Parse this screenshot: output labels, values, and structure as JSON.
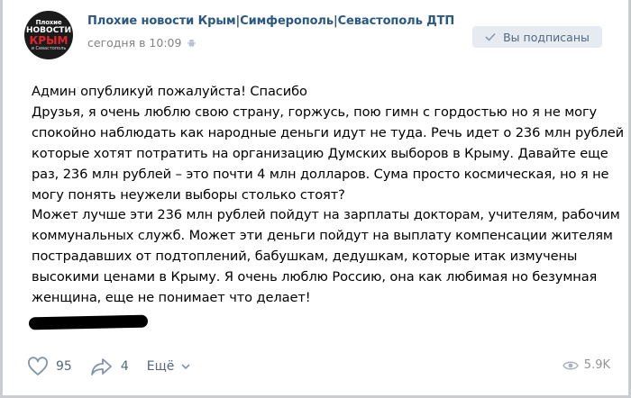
{
  "group": {
    "name": "Плохие новости Крым|Симферополь|Севастополь ДТП",
    "time": "сегодня в 10:09",
    "avatar": {
      "line1": "Плохие",
      "line2": "НОВОСТИ",
      "line3": "КРЫМ",
      "line4": "и Севастополь"
    },
    "subscribe_label": "Вы подписаны"
  },
  "post": {
    "lines": [
      "Админ опубликуй пожалуйста! Спасибо",
      "Друзья, я очень люблю свою страну, горжусь, пою гимн с гордостью но я не могу",
      "спокойно наблюдать как народные деньги идут не туда. Речь идет о 236 млн рублей",
      "которые хотят потратить на организацию Думских выборов в Крыму. Давайте еще",
      "раз, 236 млн рублей – это почти 4 млн долларов. Сума просто космическая, но я не",
      "могу понять неужели выборы столько стоят?",
      "Может лучше эти 236 млн рублей пойдут на зарплаты докторам, учителям, рабочим",
      "коммунальных служб. Может эти деньги пойдут на выплату компенсации жителям",
      "пострадавших от подтоплений, бабушкам, дедушкам, которые итак измучены",
      "высокими ценами в Крыму. Я очень люблю Россию, она как любимая но безумная",
      "женщина, еще не понимает что делает!"
    ]
  },
  "actions": {
    "likes": "95",
    "shares": "4",
    "more_label": "Ещё",
    "views": "5.9K"
  },
  "icons": {
    "like": "heart-icon",
    "share": "share-icon",
    "more": "chevron-down-icon",
    "views": "eye-icon",
    "subscribed": "check-icon",
    "platform": "android-icon"
  },
  "colors": {
    "link": "#2a5885",
    "meta": "#828282",
    "button_bg": "#e5ebf1",
    "button_text": "#55677d",
    "action": "#55677d"
  }
}
